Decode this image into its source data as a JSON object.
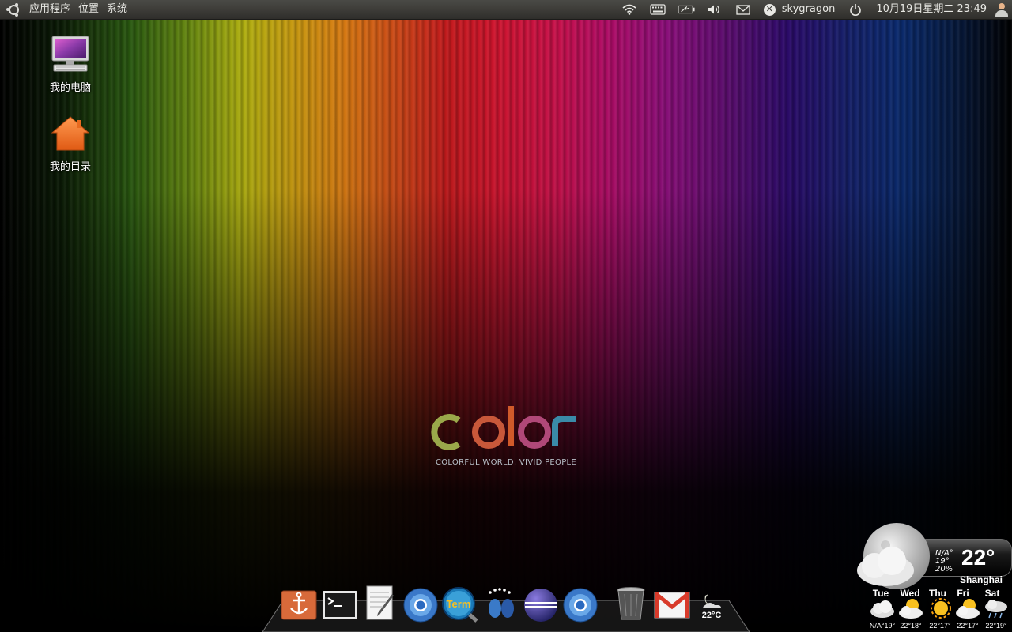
{
  "top_panel": {
    "menus": [
      "应用程序",
      "位置",
      "系统"
    ],
    "username": "skygragon",
    "datetime": "10月19日星期二 23:49",
    "icons": [
      "ubuntu-logo-icon",
      "wifi-icon",
      "keyboard-icon",
      "battery-icon",
      "volume-icon",
      "mail-icon",
      "close-x-icon",
      "power-icon",
      "user-icon"
    ]
  },
  "desktop": {
    "icons": [
      {
        "label": "我的电脑",
        "icon": "computer-icon"
      },
      {
        "label": "我的目录",
        "icon": "home-folder-icon"
      }
    ]
  },
  "wallpaper": {
    "logo_text": "color",
    "tagline": "COLORFUL WORLD, VIVID PEOPLE"
  },
  "dock": {
    "items": [
      {
        "name": "anchor-icon"
      },
      {
        "name": "terminal-icon"
      },
      {
        "name": "text-editor-icon"
      },
      {
        "name": "chromium-icon"
      },
      {
        "name": "term-search-icon",
        "text": "Term"
      },
      {
        "name": "footprints-icon"
      },
      {
        "name": "eclipse-icon"
      },
      {
        "name": "chromium-icon"
      },
      {
        "name": "trash-icon"
      },
      {
        "name": "gmail-icon"
      },
      {
        "name": "weather-dock-icon",
        "text": "22°C"
      }
    ]
  },
  "weather": {
    "temp": "22°",
    "city": "Shanghai",
    "na": "N/A°",
    "low": "19°",
    "humidity": "20%",
    "forecast": [
      {
        "day": "Tue",
        "temp": "N/A°19°",
        "icon": "cloudy-icon"
      },
      {
        "day": "Wed",
        "temp": "22°18°",
        "icon": "partly-cloudy-icon"
      },
      {
        "day": "Thu",
        "temp": "22°17°",
        "icon": "sunny-icon"
      },
      {
        "day": "Fri",
        "temp": "22°17°",
        "icon": "partly-cloudy-icon"
      },
      {
        "day": "Sat",
        "temp": "22°19°",
        "icon": "rain-icon"
      }
    ]
  }
}
